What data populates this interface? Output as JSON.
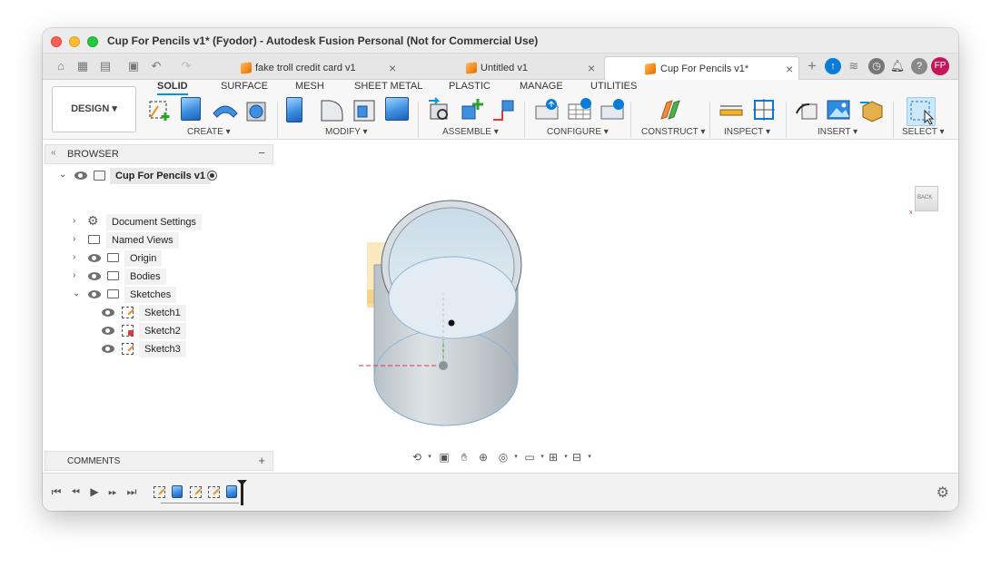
{
  "window": {
    "title": "Cup For Pencils v1* (Fyodor) - Autodesk Fusion Personal (Not for Commercial Use)"
  },
  "tabs": [
    {
      "label": "fake troll credit card v1",
      "active": false
    },
    {
      "label": "Untitled v1",
      "active": false
    },
    {
      "label": "Cup For Pencils v1*",
      "active": true
    }
  ],
  "user_initials": "FP",
  "workspace": {
    "label": "DESIGN"
  },
  "ribbon_tabs": [
    "SOLID",
    "SURFACE",
    "MESH",
    "SHEET METAL",
    "PLASTIC",
    "MANAGE",
    "UTILITIES"
  ],
  "groups": {
    "create": "CREATE",
    "modify": "MODIFY",
    "assemble": "ASSEMBLE",
    "configure": "CONFIGURE",
    "construct": "CONSTRUCT",
    "inspect": "INSPECT",
    "insert": "INSERT",
    "select": "SELECT"
  },
  "browser": {
    "title": "BROWSER",
    "root": "Cup For Pencils v1",
    "items": [
      "Document Settings",
      "Named Views",
      "Origin",
      "Bodies",
      "Sketches"
    ],
    "sketches": [
      "Sketch1",
      "Sketch2",
      "Sketch3"
    ]
  },
  "comments": {
    "title": "COMMENTS"
  },
  "viewcube": {
    "face": "BACK"
  },
  "colors": {
    "accent": "#0696d7",
    "avatar": "#c2185b"
  }
}
